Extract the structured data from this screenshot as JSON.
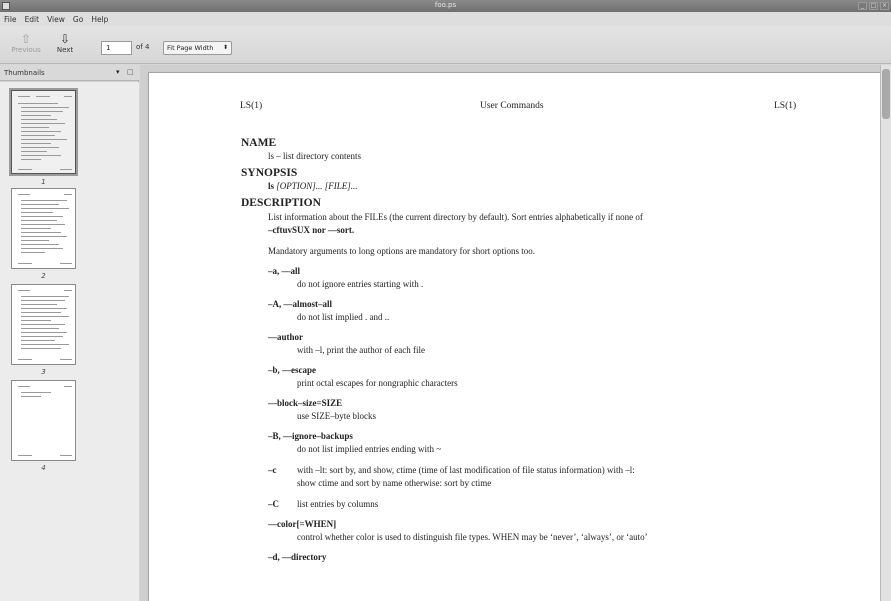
{
  "window": {
    "title": "foo.ps",
    "controls": [
      "_",
      "□",
      "×"
    ]
  },
  "menu": [
    "File",
    "Edit",
    "View",
    "Go",
    "Help"
  ],
  "toolbar": {
    "previous_label": "Previous",
    "next_label": "Next",
    "page_value": "1",
    "page_of": "of 4",
    "zoom_value": "Fit Page Width"
  },
  "sidebar": {
    "title": "Thumbnails",
    "thumbnails": [
      "1",
      "2",
      "3",
      "4"
    ]
  },
  "document": {
    "header_left": "LS(1)",
    "header_center": "User Commands",
    "header_right": "LS(1)",
    "name_heading": "NAME",
    "name_text": "ls – list directory contents",
    "synopsis_heading": "SYNOPSIS",
    "synopsis_cmd": "ls",
    "synopsis_opt": "[OPTION]... [FILE]...",
    "description_heading": "DESCRIPTION",
    "desc_line1": "List information about the FILEs (the current directory by default).  Sort entries alphabetically if none of",
    "desc_line2": "–cftuvSUX nor ––sort.",
    "desc_para2": "Mandatory arguments to long options are mandatory for short options too.",
    "options": [
      {
        "flag": "–a, ––all",
        "desc": "do not ignore entries starting with ."
      },
      {
        "flag": "–A, ––almost–all",
        "desc": "do not list implied . and .."
      },
      {
        "flag": "––author",
        "desc": "with –l, print the author of each file"
      },
      {
        "flag": "–b, ––escape",
        "desc": "print octal escapes for nongraphic characters"
      },
      {
        "flag": "––block–size=SIZE",
        "desc": "use SIZE–byte blocks"
      },
      {
        "flag": "–B, ––ignore–backups",
        "desc": "do not list implied entries ending with ~"
      }
    ],
    "opt_c_flag": "–c",
    "opt_c_line1": "with –lt: sort by, and show, ctime (time of last modification of file status information) with –l:",
    "opt_c_line2": "show ctime and sort by name otherwise: sort by ctime",
    "opt_C_flag": "–C",
    "opt_C_desc": "list entries by columns",
    "opt_color_flag": "––color[=WHEN]",
    "opt_color_desc": "control whether color is used to distinguish file types.  WHEN may be ‘never’, ‘always’, or ‘auto’",
    "opt_d_flag": "–d, ––directory"
  }
}
